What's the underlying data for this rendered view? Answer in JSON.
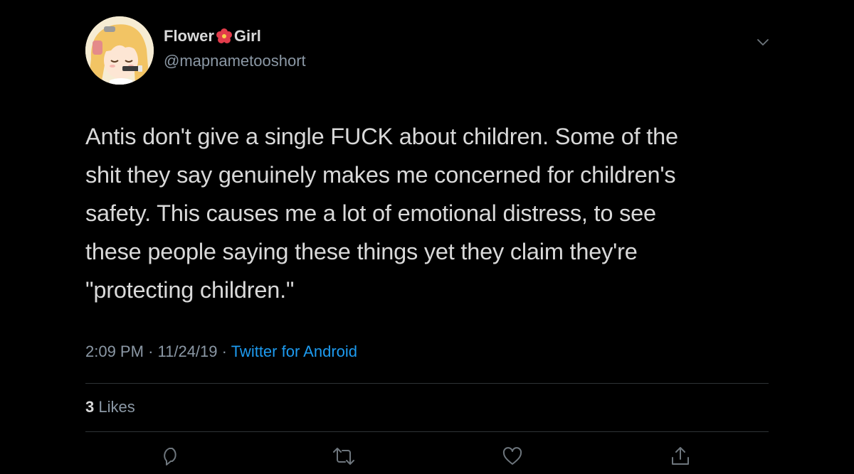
{
  "author": {
    "display_name_part1": "Flower",
    "display_name_emoji": "hibiscus-icon",
    "display_name_part2": "Girl",
    "handle": "@mapnametooshort"
  },
  "tweet": {
    "text": "Antis don't give a single FUCK about children. Some of the\nshit they say genuinely makes me concerned for children's\nsafety. This causes me a lot of emotional distress, to see\nthese people saying these things yet they claim they're\n\"protecting children.\"",
    "time": "2:09 PM",
    "separator": "·",
    "date": "11/24/19",
    "source": "Twitter for Android"
  },
  "stats": {
    "likes_count": "3",
    "likes_label": "Likes"
  },
  "actions": [
    {
      "name": "reply",
      "icon": "reply-icon"
    },
    {
      "name": "retweet",
      "icon": "retweet-icon"
    },
    {
      "name": "like",
      "icon": "heart-icon"
    },
    {
      "name": "share",
      "icon": "share-icon"
    }
  ],
  "colors": {
    "background": "#000000",
    "text": "#d9d9d9",
    "secondary_text": "#8b98a5",
    "link": "#1d9bf0",
    "divider": "#2f3336"
  }
}
